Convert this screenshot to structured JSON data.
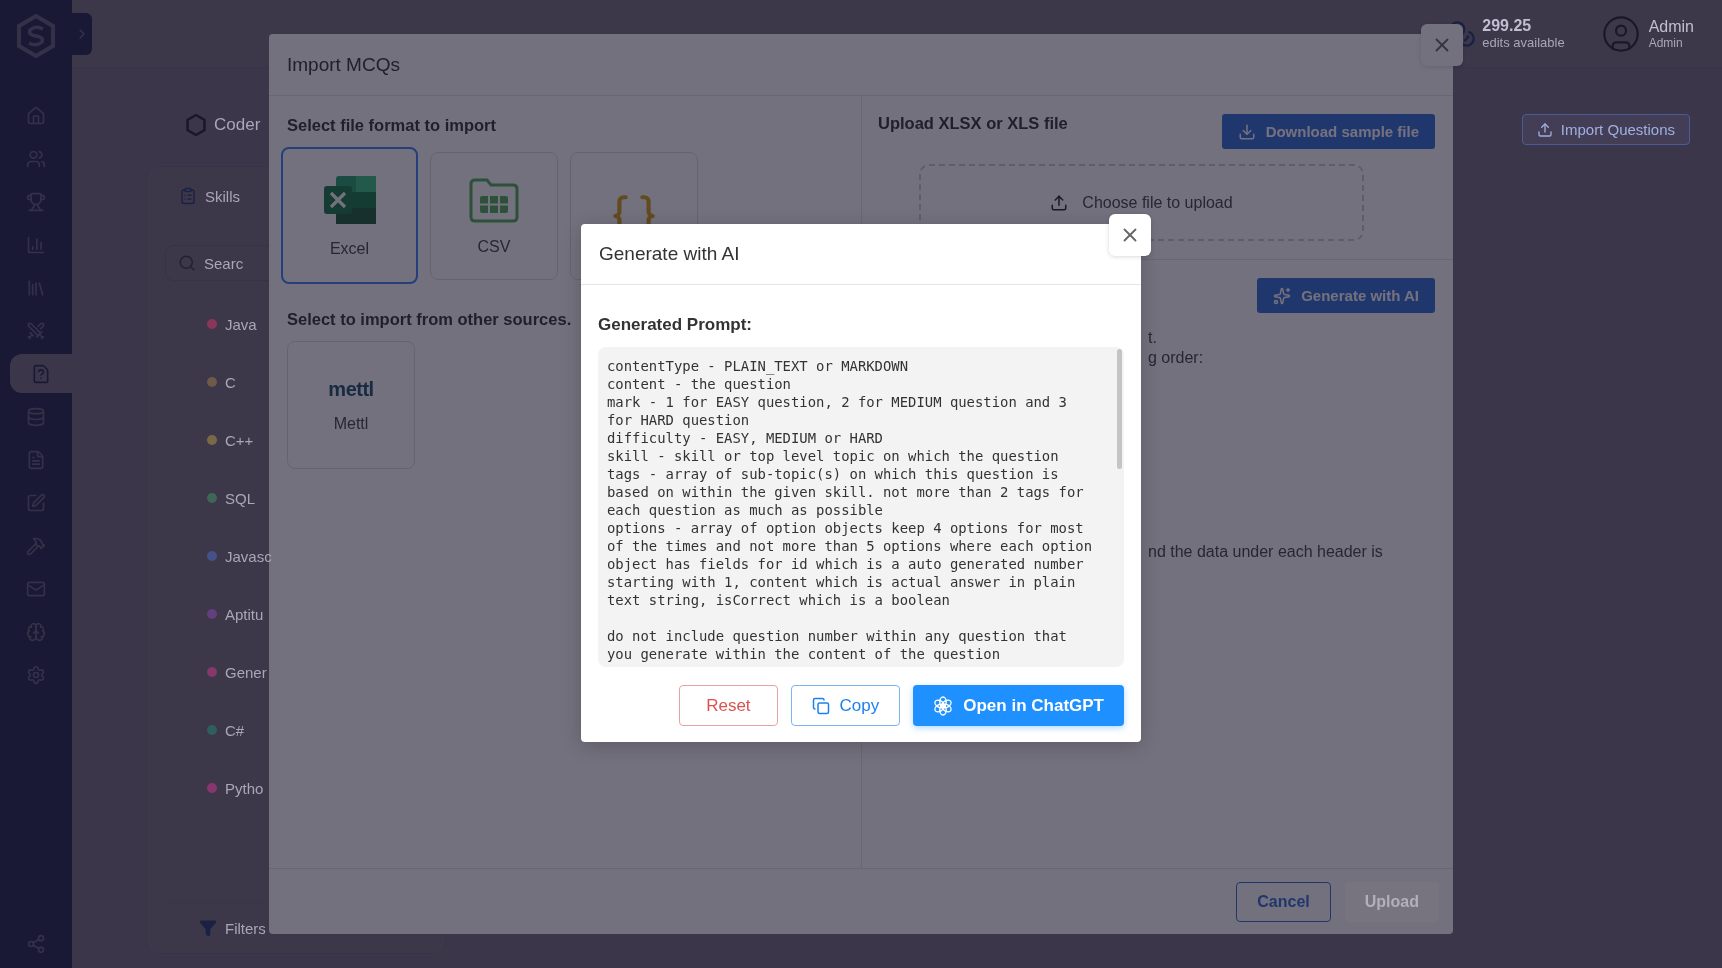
{
  "sidebar": {
    "items": [
      {
        "kind": "home",
        "selected": false
      },
      {
        "kind": "users",
        "selected": false
      },
      {
        "kind": "trophy",
        "selected": false
      },
      {
        "kind": "chart",
        "selected": false
      },
      {
        "kind": "library",
        "selected": false
      },
      {
        "kind": "swords",
        "selected": false
      },
      {
        "kind": "question",
        "selected": true
      },
      {
        "kind": "database",
        "selected": false
      },
      {
        "kind": "file",
        "selected": false
      },
      {
        "kind": "edit",
        "selected": false
      },
      {
        "kind": "hammer",
        "selected": false
      },
      {
        "kind": "mail",
        "selected": false
      },
      {
        "kind": "brain",
        "selected": false
      },
      {
        "kind": "settings",
        "selected": false
      }
    ]
  },
  "header": {
    "credits": {
      "amount": "299.25",
      "caption": "edits available"
    },
    "user": {
      "name": "Admin",
      "role": "Admin"
    }
  },
  "page": {
    "brand": "Coder",
    "import_button": "Import Questions"
  },
  "skills_panel": {
    "tab": "Skills",
    "search_placeholder": "Searc",
    "filters": "Filters",
    "skills": [
      {
        "name": "Java",
        "color": "#8a3658"
      },
      {
        "name": "C",
        "color": "#6e5a48"
      },
      {
        "name": "C++",
        "color": "#786a46"
      },
      {
        "name": "SQL",
        "color": "#3f6656"
      },
      {
        "name": "Javasc",
        "color": "#44528a"
      },
      {
        "name": "Aptitu",
        "color": "#62407e"
      },
      {
        "name": "Gener",
        "color": "#86386a"
      },
      {
        "name": "C#",
        "color": "#2f5e60"
      },
      {
        "name": "Pytho",
        "color": "#86386e"
      }
    ]
  },
  "import_modal": {
    "title": "Import MCQs",
    "format_heading": "Select file format to import",
    "formats": [
      {
        "kind": "excel",
        "label": "Excel",
        "selected": true
      },
      {
        "kind": "csv",
        "label": "CSV",
        "selected": false
      },
      {
        "kind": "json",
        "selected": false
      }
    ],
    "sources_heading": "Select to import from other sources.",
    "sources": [
      {
        "logo": "mettl",
        "label": "Mettl"
      }
    ],
    "upload_heading": "Upload XLSX or XLS file",
    "download_button": "Download sample file",
    "dropzone": "Choose file to upload",
    "generate_button": "Generate with AI",
    "partly_hidden_text": [
      "t.",
      "g order:",
      "nd the data under each header is"
    ],
    "cancel_button": "Cancel",
    "upload_button": {
      "label": "Upload",
      "disabled": true
    }
  },
  "ai_modal": {
    "title": "Generate with AI",
    "prompt_label": "Generated Prompt:",
    "prompt": "contentType - PLAIN_TEXT or MARKDOWN\ncontent - the question\nmark - 1 for EASY question, 2 for MEDIUM question and 3\nfor HARD question\ndifficulty - EASY, MEDIUM or HARD\nskill - skill or top level topic on which the question\ntags - array of sub-topic(s) on which this question is\nbased on within the given skill. not more than 2 tags for\neach question as much as possible\noptions - array of option objects keep 4 options for most\nof the times and not more than 5 options where each option\nobject has fields for id which is a auto generated number\nstarting with 1, content which is actual answer in plain\ntext string, isCorrect which is a boolean\n\ndo not include question number within any question that\nyou generate within the content of the question",
    "buttons": [
      {
        "kind": "reset",
        "label": "Reset"
      },
      {
        "kind": "copy",
        "label": "Copy"
      },
      {
        "kind": "chatgpt",
        "label": "Open in ChatGPT"
      }
    ]
  }
}
